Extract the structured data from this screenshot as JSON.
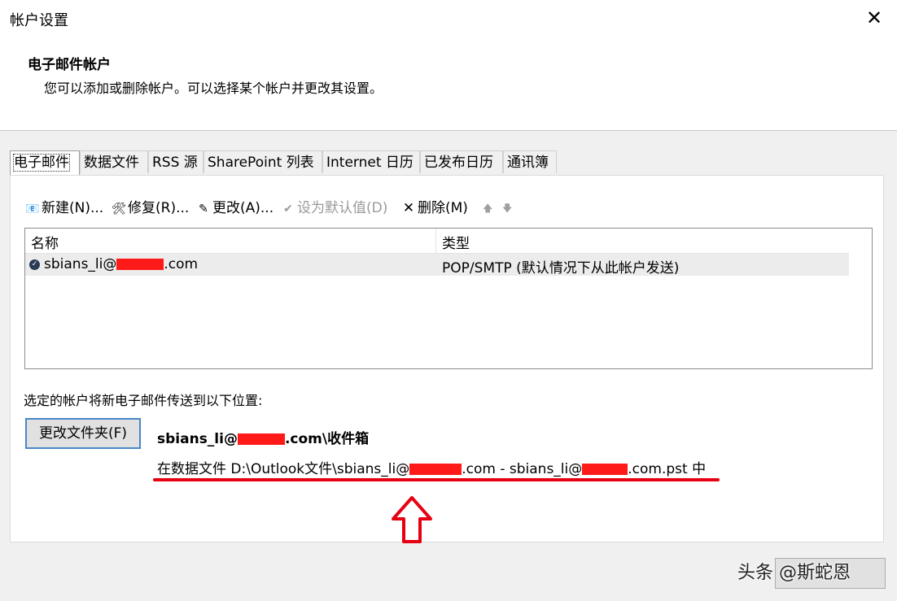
{
  "window": {
    "title": "帐户设置",
    "close_label": "✕"
  },
  "header": {
    "title": "电子邮件帐户",
    "description": "您可以添加或删除帐户。可以选择某个帐户并更改其设置。"
  },
  "tabs": [
    {
      "label": "电子邮件"
    },
    {
      "label": "数据文件"
    },
    {
      "label": "RSS 源"
    },
    {
      "label": "SharePoint 列表"
    },
    {
      "label": "Internet 日历"
    },
    {
      "label": "已发布日历"
    },
    {
      "label": "通讯簿"
    }
  ],
  "toolbar": {
    "new_label": "新建(N)...",
    "repair_label": "修复(R)...",
    "change_label": "更改(A)...",
    "default_label": "设为默认值(D)",
    "delete_label": "删除(M)",
    "up_arrow": "🡅",
    "down_arrow": "🡇"
  },
  "accounts": {
    "columns": [
      "名称",
      "类型"
    ],
    "rows": [
      {
        "name_prefix": "sbians_li@",
        "name_suffix": ".com",
        "type": "POP/SMTP (默认情况下从此帐户发送)"
      }
    ]
  },
  "delivery": {
    "label": "选定的帐户将新电子邮件传送到以下位置:",
    "change_folder_label": "更改文件夹(F)",
    "inbox_prefix": "sbians_li@",
    "inbox_suffix": ".com\\收件箱",
    "datafile_part1": "在数据文件 D:\\Outlook文件\\sbians_li@",
    "datafile_part2": ".com - sbians_li@",
    "datafile_part3": ".com.pst 中"
  },
  "watermark": "头条 @斯蛇恩",
  "colors": {
    "annotation": "#e60012",
    "selection_border": "#4a86c8"
  }
}
